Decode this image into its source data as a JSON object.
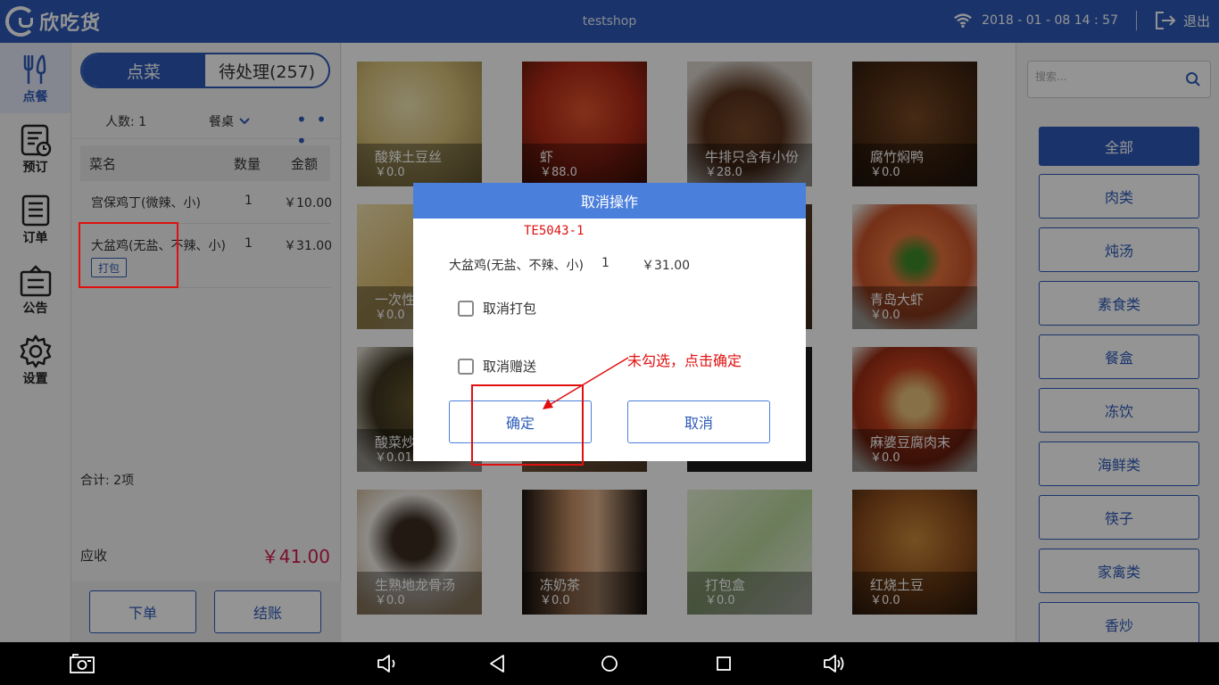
{
  "topbar": {
    "logo_text": "欣吃货",
    "shop_name": "testshop",
    "datetime": "2018 - 01 - 08  14 : 57",
    "exit_label": "退出"
  },
  "nav": [
    {
      "label": "点餐",
      "icon": "fork-knife-icon",
      "active": true
    },
    {
      "label": "预订",
      "icon": "reservation-icon",
      "active": false
    },
    {
      "label": "订单",
      "icon": "order-list-icon",
      "active": false
    },
    {
      "label": "公告",
      "icon": "notice-board-icon",
      "active": false
    },
    {
      "label": "设置",
      "icon": "gear-icon",
      "active": false
    }
  ],
  "order_panel": {
    "tabs": [
      "点菜",
      "待处理(257)"
    ],
    "people": "人数: 1",
    "table_label": "餐桌",
    "more": "• • •",
    "columns": [
      "菜名",
      "数量",
      "金额"
    ],
    "items": [
      {
        "name": "宫保鸡丁(微辣、小)",
        "qty": "1",
        "amount": "￥10.00"
      },
      {
        "name": "大盆鸡(无盐、不辣、小)",
        "qty": "1",
        "amount": "￥31.00",
        "tag": "打包"
      }
    ],
    "total": "合计:  2项",
    "due_label": "应收",
    "due_amount": "￥41.00",
    "submit_label": "下单",
    "checkout_label": "结账"
  },
  "dishes": [
    {
      "name": "酸辣土豆丝",
      "price": "￥0.0"
    },
    {
      "name": "虾",
      "price": "￥88.0"
    },
    {
      "name": "牛排只含有小份",
      "price": "￥28.0"
    },
    {
      "name": "腐竹焖鸭",
      "price": "￥0.0"
    },
    {
      "name": "一次性",
      "price": "￥0.0"
    },
    {
      "name": "",
      "price": ""
    },
    {
      "name": "",
      "price": ""
    },
    {
      "name": "青岛大虾",
      "price": "￥0.0"
    },
    {
      "name": "酸菜炒",
      "price": "￥0.01"
    },
    {
      "name": "",
      "price": ""
    },
    {
      "name": "",
      "price": ""
    },
    {
      "name": "麻婆豆腐肉末",
      "price": "￥0.0"
    },
    {
      "name": "生熟地龙骨汤",
      "price": "￥0.0"
    },
    {
      "name": "冻奶茶",
      "price": "￥0.0"
    },
    {
      "name": "打包盒",
      "price": "￥0.0"
    },
    {
      "name": "红烧土豆",
      "price": "￥0.0"
    }
  ],
  "search": {
    "placeholder": "搜索..."
  },
  "categories": [
    "全部",
    "肉类",
    "炖汤",
    "素食类",
    "餐盒",
    "冻饮",
    "海鲜类",
    "筷子",
    "家禽类",
    "香炒"
  ],
  "dialog": {
    "title": "取消操作",
    "code": "TE5043-1",
    "item_name": "大盆鸡(无盐、不辣、小)",
    "item_qty": "1",
    "item_amount": "￥31.00",
    "cancel_pack_label": "取消打包",
    "cancel_gift_label": "取消赠送",
    "confirm_label": "确定",
    "cancel_label": "取消"
  },
  "annotation": {
    "text": "未勾选，点击确定"
  },
  "colors": {
    "brand": "#2e5bb8",
    "dialog_header": "#4a7fdc",
    "annotation": "#e01010",
    "price": "#d11a4b"
  }
}
